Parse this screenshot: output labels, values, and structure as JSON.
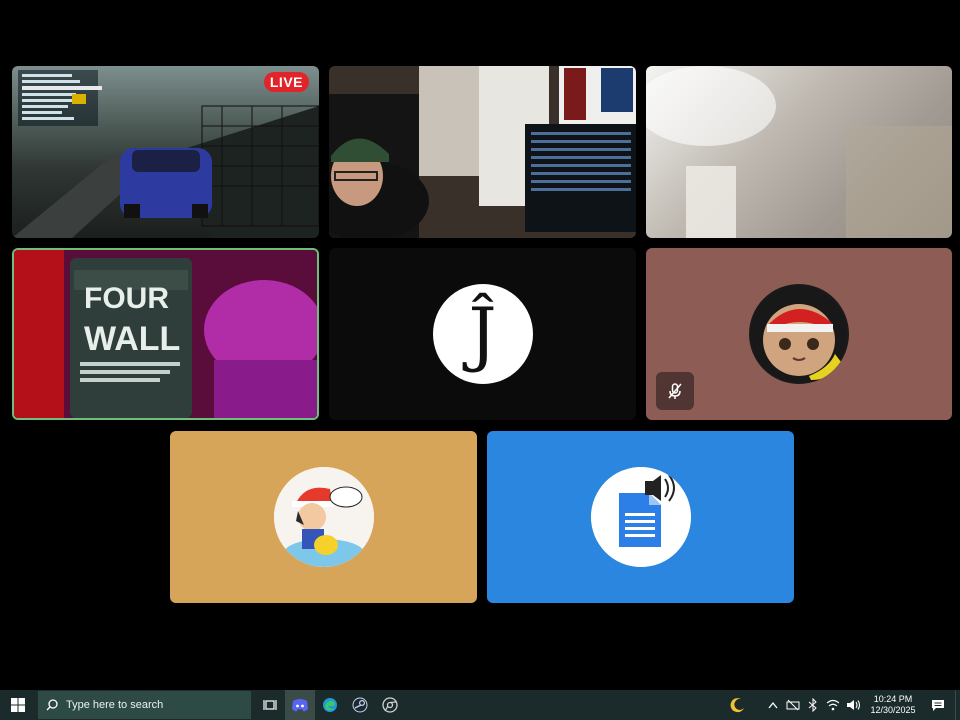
{
  "tiles": {
    "live_badge": "LIVE",
    "jay_initial": "Ĵ"
  },
  "taskbar": {
    "search_placeholder": "Type here to search",
    "clock_time": "10:24 PM",
    "clock_date": "12/30/2025"
  },
  "colors": {
    "tile_brown": "#8d5c55",
    "tile_tan": "#d7a55a",
    "tile_blue": "#2b86e0",
    "active_border": "#6fbf7a",
    "live_red": "#e0242a"
  },
  "icons": [
    "windows-icon",
    "search-icon",
    "task-view-icon",
    "discord-icon",
    "edge-icon",
    "steam-icon",
    "chrome-icon",
    "moon-icon",
    "chevron-up-icon",
    "network-icon",
    "volume-icon",
    "notifications-icon",
    "mic-muted-icon",
    "speaker-icon"
  ]
}
